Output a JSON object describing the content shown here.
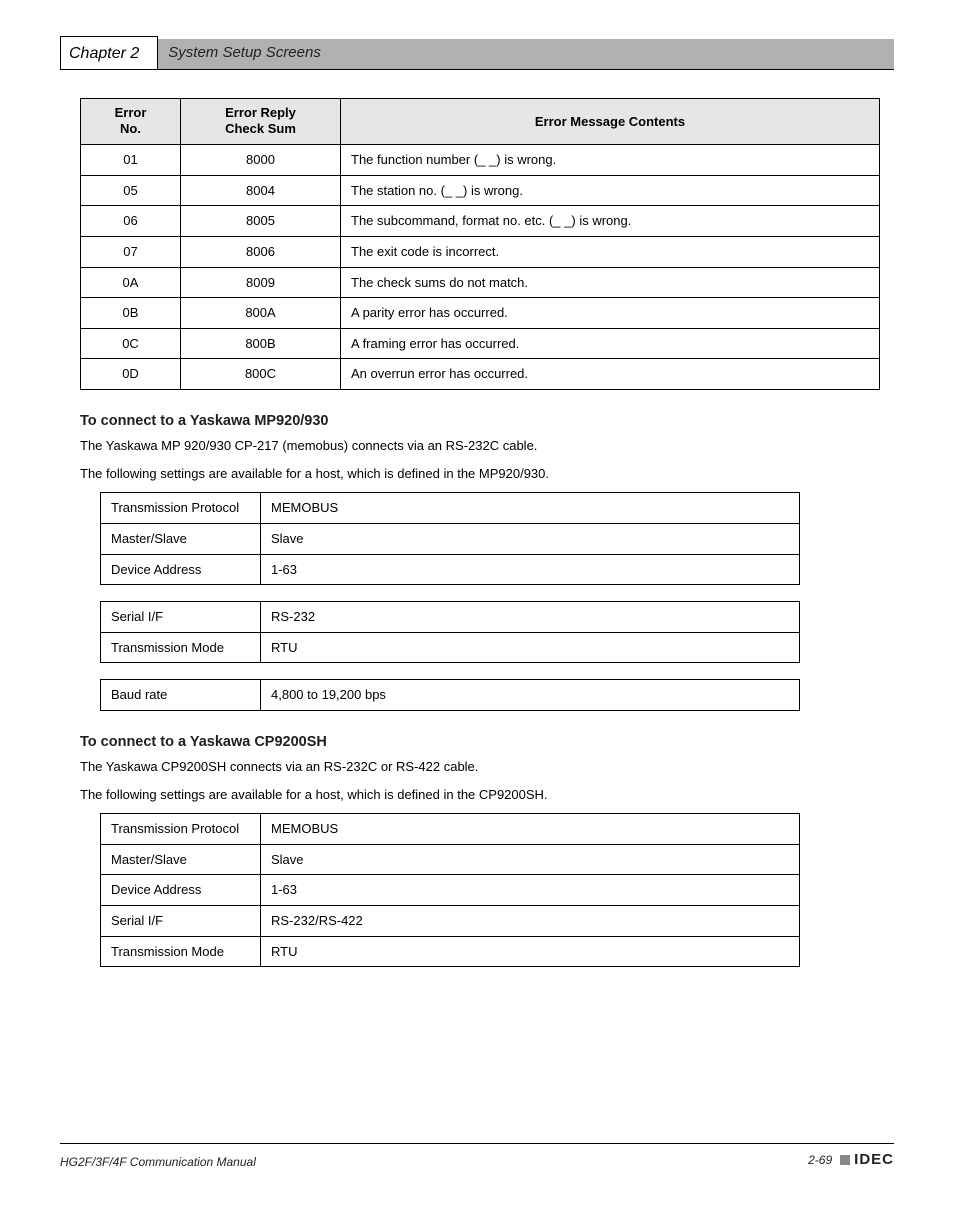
{
  "header": {
    "chapter": "Chapter 2",
    "title": "System Setup Screens"
  },
  "errTable": {
    "headers": [
      "Error No.",
      "Error Reply Check Sum",
      "Error Message Contents"
    ],
    "rows": [
      [
        "01",
        "8000",
        "The function number (_ _) is wrong."
      ],
      [
        "05",
        "8004",
        "The station no. (_ _) is wrong."
      ],
      [
        "06",
        "8005",
        "The subcommand, format no. etc. (_ _) is wrong."
      ],
      [
        "07",
        "8006",
        "The exit code is incorrect."
      ],
      [
        "0A",
        "8009",
        "The check sums do not match."
      ],
      [
        "0B",
        "800A",
        "A parity error has occurred."
      ],
      [
        "0C",
        "800B",
        "A framing error has occurred."
      ],
      [
        "0D",
        "800C",
        "An overrun error has occurred."
      ]
    ]
  },
  "section1": {
    "title": "To connect to a Yaskawa MP920/930",
    "p1": "The Yaskawa MP 920/930 CP-217 (memobus) connects via an RS-232C cable.",
    "p2": "The following settings are available for a host, which is defined in the MP920/930.",
    "t1": [
      [
        "Transmission Protocol",
        "MEMOBUS"
      ],
      [
        "Master/Slave",
        "Slave"
      ],
      [
        "Device Address",
        "1-63"
      ]
    ],
    "t2": [
      [
        "Serial I/F",
        "RS-232"
      ],
      [
        "Transmission Mode",
        "RTU"
      ]
    ],
    "t3": [
      [
        "Baud rate",
        "4,800 to 19,200 bps"
      ]
    ]
  },
  "section2": {
    "title": "To connect to a Yaskawa CP9200SH",
    "p1": "The Yaskawa CP9200SH connects via an RS-232C or RS-422 cable.",
    "p2": "The following settings are available for a host, which is defined in the CP9200SH.",
    "t1": [
      [
        "Transmission Protocol",
        "MEMOBUS"
      ],
      [
        "Master/Slave",
        "Slave"
      ],
      [
        "Device Address",
        "1-63"
      ],
      [
        "Serial I/F",
        "RS-232/RS-422"
      ],
      [
        "Transmission Mode",
        "RTU"
      ]
    ]
  },
  "footer": {
    "left": "HG2F/3F/4F Communication Manual",
    "page": "2-69",
    "logo": "IDEC"
  }
}
